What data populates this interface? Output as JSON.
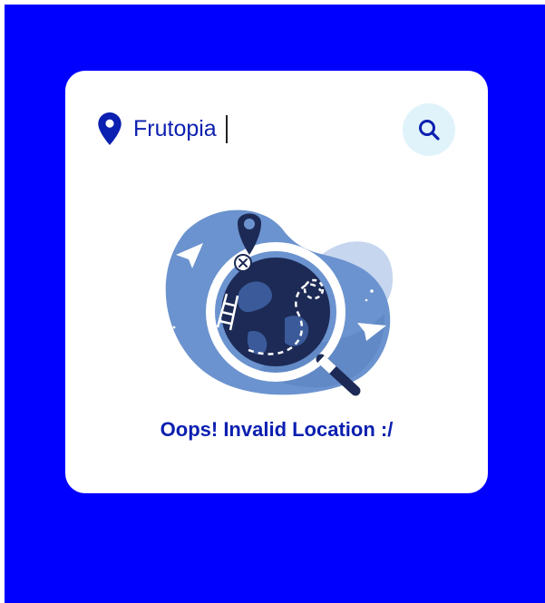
{
  "search": {
    "value": "Frutopia",
    "icon": "search-icon",
    "location_icon": "map-pin-icon"
  },
  "result": {
    "message": "Oops! Invalid Location :/",
    "illustration": "globe-magnifier-illustration"
  },
  "colors": {
    "background": "#0000ff",
    "card": "#ffffff",
    "accent": "#0b1fb0",
    "search_button_bg": "#e0f3fb",
    "illustration_blue": "#6b93cf",
    "illustration_dark": "#1c2a55"
  }
}
